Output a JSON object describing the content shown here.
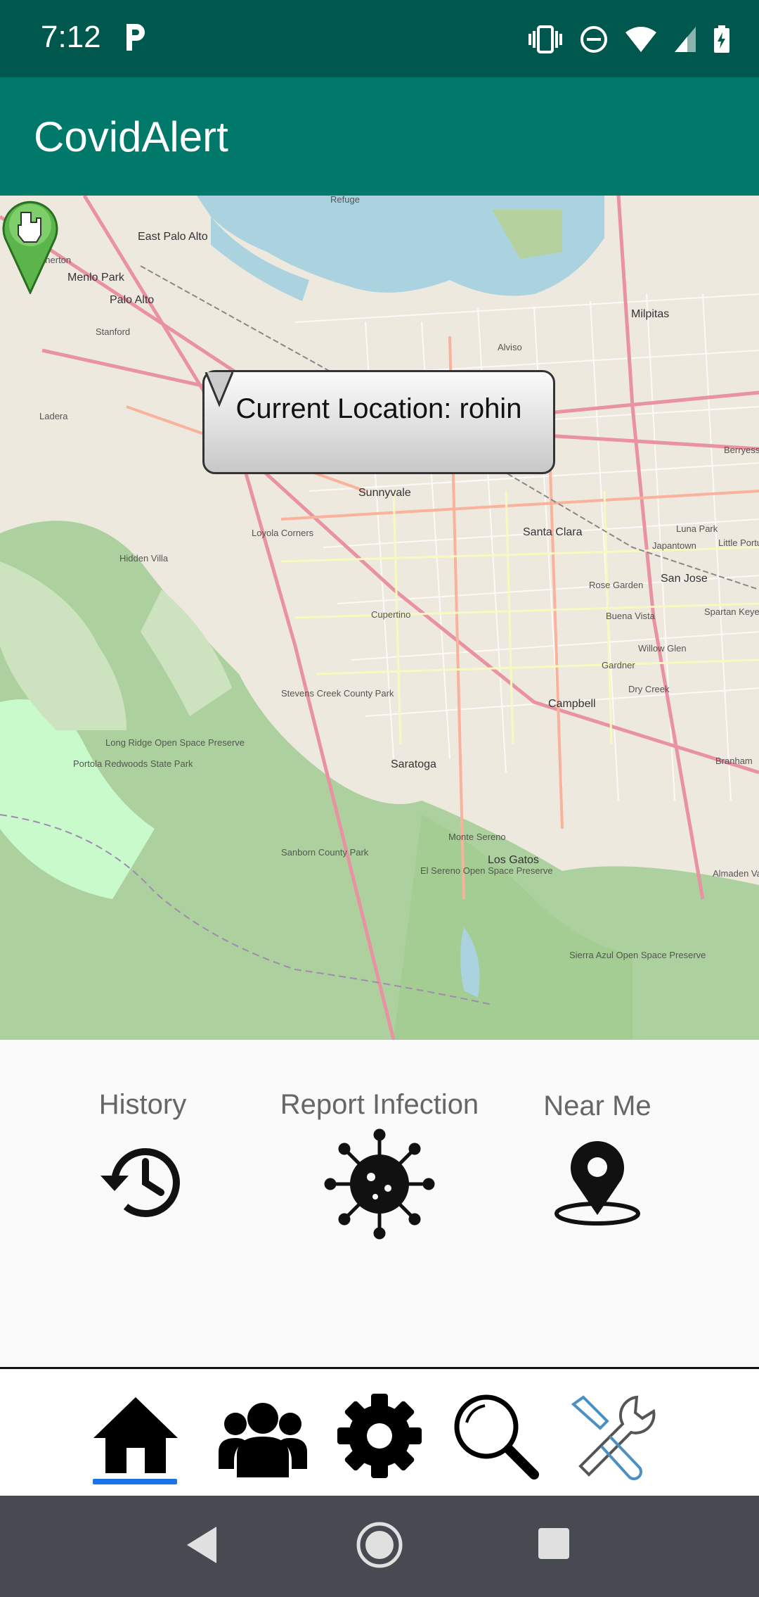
{
  "status": {
    "time": "7:12"
  },
  "app": {
    "title": "CovidAlert"
  },
  "map": {
    "callout": "Current Location: rohin",
    "places": [
      "Refuge",
      "East Palo Alto",
      "Menlo Park",
      "Palo Alto",
      "Stanford",
      "Alviso",
      "Milpitas",
      "Sunnyvale",
      "Santa Clara",
      "San Jose",
      "Cupertino",
      "Loyola Corners",
      "Campbell",
      "Saratoga",
      "Los Gatos",
      "Monte Sereno",
      "Berryessa",
      "Japantown",
      "Rose Garden",
      "Willow Glen",
      "Dry Creek",
      "Almaden Val",
      "Branham",
      "Luna Park",
      "Little Portug",
      "Spartan Keyes",
      "Buena Vista",
      "Gardner",
      "Atherton",
      "Ladera",
      "Hidden Villa",
      "Sanborn County Park",
      "Sierra Azul Open Space Preserve",
      "El Sereno Open Space Preserve",
      "Long Ridge Open Space Preserve",
      "Portola Redwoods State Park",
      "Stevens Creek County Park"
    ]
  },
  "actions": [
    {
      "label": "History",
      "icon": "history-icon"
    },
    {
      "label": "Report Infection",
      "icon": "virus-icon"
    },
    {
      "label": "Near Me",
      "icon": "location-pin-icon"
    }
  ],
  "bottom_nav": [
    "home-icon",
    "people-icon",
    "gear-icon",
    "search-icon",
    "tools-icon"
  ],
  "colors": {
    "status_bar": "#00574d",
    "app_bar": "#00796b",
    "active_indicator": "#1a73e8",
    "system_nav": "#474b51"
  }
}
